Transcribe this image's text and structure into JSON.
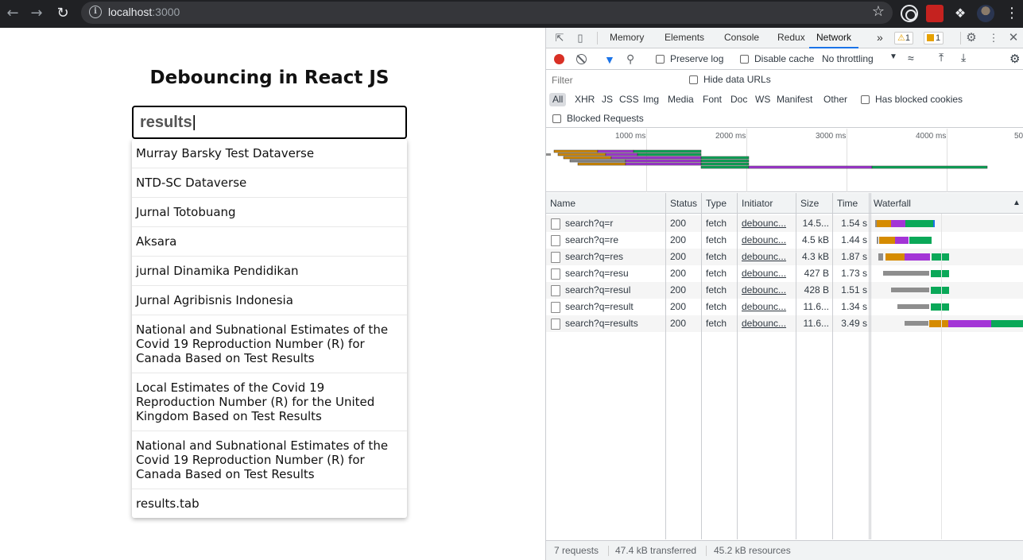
{
  "browser": {
    "url_host": "localhost",
    "url_port": ":3000"
  },
  "page": {
    "title": "Debouncing in React JS",
    "search_value": "results",
    "results": [
      "Murray Barsky Test Dataverse",
      "NTD-SC Dataverse",
      "Jurnal Totobuang",
      "Aksara",
      "jurnal Dinamika Pendidikan",
      "Jurnal Agribisnis Indonesia",
      "National and Subnational Estimates of the Covid 19 Reproduction Number (R) for Canada Based on Test Results",
      "Local Estimates of the Covid 19 Reproduction Number (R) for the United Kingdom Based on Test Results",
      "National and Subnational Estimates of the Covid 19 Reproduction Number (R) for Canada Based on Test Results",
      "results.tab"
    ]
  },
  "devtools": {
    "tabs": [
      "Memory",
      "Elements",
      "Console",
      "Redux",
      "Network"
    ],
    "active_tab": "Network",
    "more_tabs": "»",
    "warnings_count": "1",
    "issues_count": "1",
    "toolbar": {
      "preserve_log": "Preserve log",
      "disable_cache": "Disable cache",
      "throttling": "No throttling"
    },
    "filter": {
      "placeholder": "Filter",
      "hide_data_urls": "Hide data URLs",
      "types": [
        "All",
        "XHR",
        "JS",
        "CSS",
        "Img",
        "Media",
        "Font",
        "Doc",
        "WS",
        "Manifest",
        "Other"
      ],
      "has_blocked_cookies": "Has blocked cookies",
      "blocked_requests": "Blocked Requests"
    },
    "overview_ticks": [
      "1000 ms",
      "2000 ms",
      "3000 ms",
      "4000 ms",
      "50"
    ],
    "columns": [
      "Name",
      "Status",
      "Type",
      "Initiator",
      "Size",
      "Time",
      "Waterfall"
    ],
    "rows": [
      {
        "name": "search?q=r",
        "status": "200",
        "type": "fetch",
        "initiator": "debounc...",
        "size": "14.5...",
        "time": "1.54 s"
      },
      {
        "name": "search?q=re",
        "status": "200",
        "type": "fetch",
        "initiator": "debounc...",
        "size": "4.5 kB",
        "time": "1.44 s"
      },
      {
        "name": "search?q=res",
        "status": "200",
        "type": "fetch",
        "initiator": "debounc...",
        "size": "4.3 kB",
        "time": "1.87 s"
      },
      {
        "name": "search?q=resu",
        "status": "200",
        "type": "fetch",
        "initiator": "debounc...",
        "size": "427 B",
        "time": "1.73 s"
      },
      {
        "name": "search?q=resul",
        "status": "200",
        "type": "fetch",
        "initiator": "debounc...",
        "size": "428 B",
        "time": "1.51 s"
      },
      {
        "name": "search?q=result",
        "status": "200",
        "type": "fetch",
        "initiator": "debounc...",
        "size": "11.6...",
        "time": "1.34 s"
      },
      {
        "name": "search?q=results",
        "status": "200",
        "type": "fetch",
        "initiator": "debounc...",
        "size": "11.6...",
        "time": "3.49 s"
      }
    ],
    "status": {
      "requests": "7 requests",
      "transferred": "47.4 kB transferred",
      "resources": "45.2 kB resources"
    },
    "colors": {
      "waiting": "#8e8e8e",
      "connect": "#d58b00",
      "ssl": "#a335d6",
      "download": "#0aa858",
      "accent": "#1a73e8"
    }
  }
}
